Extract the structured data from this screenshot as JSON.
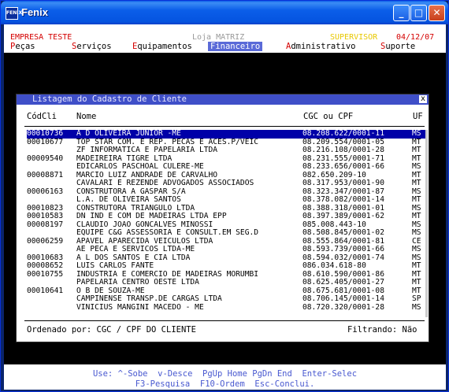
{
  "window": {
    "title": "Fenix",
    "icon_label": "FENIX",
    "min": "_",
    "max": "□",
    "close": "✕"
  },
  "topbar": {
    "company": "EMPRESA TESTE",
    "store": "Loja MATRIZ",
    "user": "SUPERVISOR",
    "date": "04/12/07",
    "company_color": "#d40000",
    "store_color": "#ffffff",
    "user_color": "#e8c800",
    "date_color": "#d40000"
  },
  "menu": [
    {
      "hotkey": "P",
      "rest": "eças",
      "active": false
    },
    {
      "hotkey": "S",
      "rest": "erviços",
      "active": false
    },
    {
      "hotkey": "E",
      "rest": "quipamentos",
      "active": false
    },
    {
      "hotkey": "F",
      "rest": "inanceiro",
      "active": true
    },
    {
      "hotkey": "A",
      "rest": "dministrativo",
      "active": false
    },
    {
      "hotkey": "S",
      "rest": "uporte",
      "active": false
    }
  ],
  "dialog": {
    "title": "Listagem do Cadastro de Cliente",
    "close": "x",
    "headers": {
      "code": "CódCli",
      "name": "Nome",
      "doc": "CGC ou CPF",
      "uf": "UF"
    },
    "rows": [
      {
        "code": "00010736",
        "name": "A D OLIVEIRA JUNIOR -ME",
        "doc": "08.208.622/0001-11",
        "uf": "MS",
        "selected": true
      },
      {
        "code": "00010677",
        "name": "TOP STAR COM. E REP. PECAS E ACES.P/VEIC",
        "doc": "08.209.554/0001-05",
        "uf": "MT"
      },
      {
        "code": "",
        "name": "ZF INFORMATICA E PAPELARIA LTDA",
        "doc": "08.216.108/0001-28",
        "uf": "MT"
      },
      {
        "code": "00009540",
        "name": "MADEIREIRA TIGRE LTDA",
        "doc": "08.231.555/0001-71",
        "uf": "MT"
      },
      {
        "code": "",
        "name": "EDICARLOS PASCHOAL CULERE-ME",
        "doc": "08.233.656/0001-66",
        "uf": "MS"
      },
      {
        "code": "00008871",
        "name": "MARCIO LUIZ ANDRADE DE CARVALHO",
        "doc": "082.650.209-10",
        "uf": "MT"
      },
      {
        "code": "",
        "name": "CAVALARI E REZENDE ADVOGADOS ASSOCIADOS",
        "doc": "08.317.953/0001-90",
        "uf": "MT"
      },
      {
        "code": "00006163",
        "name": "CONSTRUTORA A GASPAR S/A",
        "doc": "08.323.347/0001-87",
        "uf": "MS"
      },
      {
        "code": "",
        "name": "L.A. DE OLIVEIRA SANTOS",
        "doc": "08.378.082/0001-14",
        "uf": "MT"
      },
      {
        "code": "00010823",
        "name": "CONSTRUTORA TRIANGULO LTDA",
        "doc": "08.388.318/0001-01",
        "uf": "MS"
      },
      {
        "code": "00010583",
        "name": "DN IND E COM DE MADEIRAS LTDA EPP",
        "doc": "08.397.389/0001-62",
        "uf": "MT"
      },
      {
        "code": "00008197",
        "name": "CLAUDIO JOAO GONCALVES MINOSSI",
        "doc": "085.008.443-10",
        "uf": "MS"
      },
      {
        "code": "",
        "name": "EQUIPE C&G ASSESSORIA E CONSULT.EM SEG.D",
        "doc": "08.508.845/0001-02",
        "uf": "MS"
      },
      {
        "code": "00006259",
        "name": "APAVEL APARECIDA VEICULOS LTDA",
        "doc": "08.555.864/0001-81",
        "uf": "CE"
      },
      {
        "code": "",
        "name": "AE PECA E SERVICOS LTDA-ME",
        "doc": "08.593.739/0001-66",
        "uf": "MS"
      },
      {
        "code": "00010683",
        "name": "A L DOS SANTOS E CIA LTDA",
        "doc": "08.594.032/0001-74",
        "uf": "MS"
      },
      {
        "code": "00008652",
        "name": "LUIS CARLOS FANTE",
        "doc": "086.034.618-80",
        "uf": "MT"
      },
      {
        "code": "00010755",
        "name": "INDUSTRIA E COMERCIO DE MADEIRAS MORUMBI",
        "doc": "08.610.590/0001-86",
        "uf": "MT"
      },
      {
        "code": "",
        "name": "PAPELARIA CENTRO OESTE LTDA",
        "doc": "08.625.405/0001-27",
        "uf": "MT"
      },
      {
        "code": "00010641",
        "name": "O B DE SOUZA-ME",
        "doc": "08.675.681/0001-08",
        "uf": "MT"
      },
      {
        "code": "",
        "name": "CAMPINENSE TRANSP.DE CARGAS LTDA",
        "doc": "08.706.145/0001-14",
        "uf": "SP"
      },
      {
        "code": "",
        "name": "VINICIUS MANGINI MACEDO - ME",
        "doc": "08.720.320/0001-28",
        "uf": "MS"
      }
    ],
    "order_label": "Ordenado por: CGC / CPF DO CLIENTE",
    "filter_label": "Filtrando: Não"
  },
  "hints": {
    "line1": "Use: ^-Sobe  v-Desce  PgUp Home PgDn End  Enter-Selec",
    "line2": "F3-Pesquisa  F10-Ordem  Esc-Conclui."
  }
}
